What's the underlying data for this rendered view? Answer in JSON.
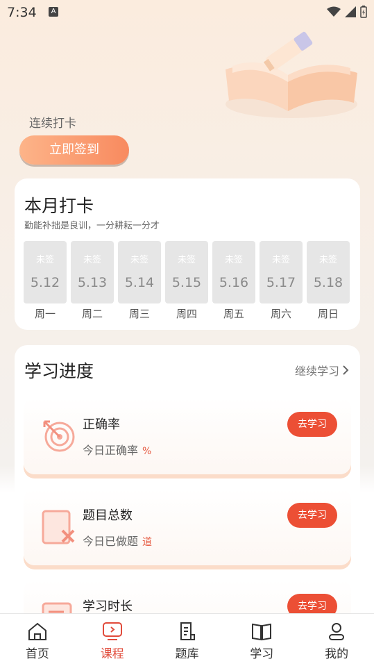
{
  "status_bar": {
    "time": "7:34"
  },
  "header": {
    "streak_label": "连续打卡",
    "signin_button": "立即签到"
  },
  "checkin": {
    "title": "本月打卡",
    "motto": "勤能补拙是良训，一分耕耘一分才",
    "days": [
      {
        "status": "未签",
        "date": "5.12",
        "weekday": "周一"
      },
      {
        "status": "未签",
        "date": "5.13",
        "weekday": "周二"
      },
      {
        "status": "未签",
        "date": "5.14",
        "weekday": "周三"
      },
      {
        "status": "未签",
        "date": "5.15",
        "weekday": "周四"
      },
      {
        "status": "未签",
        "date": "5.16",
        "weekday": "周五"
      },
      {
        "status": "未签",
        "date": "5.17",
        "weekday": "周六"
      },
      {
        "status": "未签",
        "date": "5.18",
        "weekday": "周日"
      }
    ]
  },
  "progress": {
    "title": "学习进度",
    "continue_label": "继续学习",
    "items": [
      {
        "name": "正确率",
        "desc": "今日正确率",
        "unit": "%",
        "button": "去学习",
        "icon": "target-icon"
      },
      {
        "name": "题目总数",
        "desc": "今日已做题",
        "unit": "道",
        "button": "去学习",
        "icon": "question-doc-icon"
      },
      {
        "name": "学习时长",
        "desc": "",
        "unit": "",
        "button": "去学习",
        "icon": "study-time-icon"
      }
    ]
  },
  "nav": {
    "tabs": [
      {
        "label": "首页",
        "icon": "home-icon"
      },
      {
        "label": "课程",
        "icon": "course-icon",
        "active": true
      },
      {
        "label": "题库",
        "icon": "question-bank-icon"
      },
      {
        "label": "学习",
        "icon": "book-icon"
      },
      {
        "label": "我的",
        "icon": "profile-icon"
      }
    ]
  },
  "colors": {
    "accent": "#ec4f35",
    "active_tab": "#e14b3b",
    "signin_gradient_start": "#fdb489",
    "signin_gradient_end": "#f88a5f"
  }
}
